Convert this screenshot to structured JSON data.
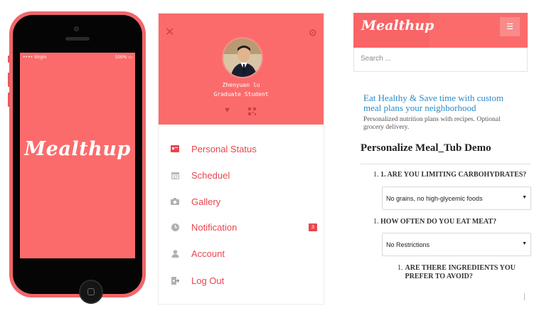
{
  "phone": {
    "status_carrier": "•••• Virgin",
    "status_time": "",
    "status_battery": "100%",
    "splash_title": "Mealthup"
  },
  "menu": {
    "profile": {
      "name": "Zhenyuan lu",
      "role": "Graduate Student"
    },
    "items": [
      {
        "label": "Personal Status",
        "icon": "id-card-icon"
      },
      {
        "label": "Scheduel",
        "icon": "calendar-icon"
      },
      {
        "label": "Gallery",
        "icon": "camera-icon"
      },
      {
        "label": "Notification",
        "icon": "clock-icon",
        "badge": "3"
      },
      {
        "label": "Account",
        "icon": "user-icon"
      },
      {
        "label": "Log Out",
        "icon": "logout-icon"
      }
    ]
  },
  "web": {
    "logo": "Mealthup",
    "search_placeholder": "Search ...",
    "hero_title": "Eat Healthy & Save time with custom meal plans your neighborhood",
    "hero_subtitle": "Personalized nutrition plans with recipes. Optional grocery delivery.",
    "demo_title": "Personalize Meal_Tub Demo",
    "questions": [
      {
        "num": "1.",
        "text": "1. ARE YOU LIMITING CARBOHYDRATES?",
        "selected": "No grains, no high-glycemic foods"
      },
      {
        "num": "1.",
        "text": "HOW OFTEN DO YOU EAT MEAT?",
        "selected": "No Restrictions"
      },
      {
        "num": "1.",
        "text": "ARE THERE INGREDIENTS YOU PREFER TO AVOID?"
      }
    ]
  },
  "colors": {
    "brand": "#fc6b6b",
    "accent_dark": "#e8464f",
    "link": "#2a8ac6"
  }
}
